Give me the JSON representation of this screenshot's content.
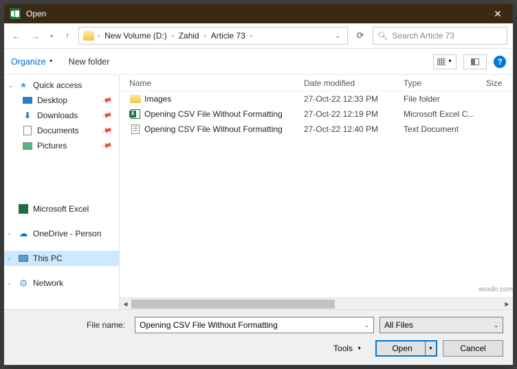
{
  "window": {
    "title": "Open"
  },
  "breadcrumb": {
    "items": [
      "New Volume (D:)",
      "Zahid",
      "Article 73"
    ]
  },
  "search": {
    "placeholder": "Search Article 73"
  },
  "toolbar": {
    "organize": "Organize",
    "newfolder": "New folder"
  },
  "sidebar": {
    "quick": "Quick access",
    "desktop": "Desktop",
    "downloads": "Downloads",
    "documents": "Documents",
    "pictures": "Pictures",
    "excel": "Microsoft Excel",
    "onedrive": "OneDrive - Person",
    "thispc": "This PC",
    "network": "Network"
  },
  "columns": {
    "name": "Name",
    "date": "Date modified",
    "type": "Type",
    "size": "Size"
  },
  "files": [
    {
      "icon": "folder",
      "name": "Images",
      "date": "27-Oct-22 12:33 PM",
      "type": "File folder"
    },
    {
      "icon": "xlsx",
      "name": "Opening CSV File Without Formatting",
      "date": "27-Oct-22 12:19 PM",
      "type": "Microsoft Excel C..."
    },
    {
      "icon": "txt",
      "name": "Opening CSV File Without Formatting",
      "date": "27-Oct-22 12:40 PM",
      "type": "Text Document"
    }
  ],
  "footer": {
    "fn_label": "File name:",
    "fn_value": "Opening CSV File Without Formatting",
    "filter": "All Files",
    "tools": "Tools",
    "open": "Open",
    "cancel": "Cancel"
  },
  "watermark": "wsxdn.com"
}
